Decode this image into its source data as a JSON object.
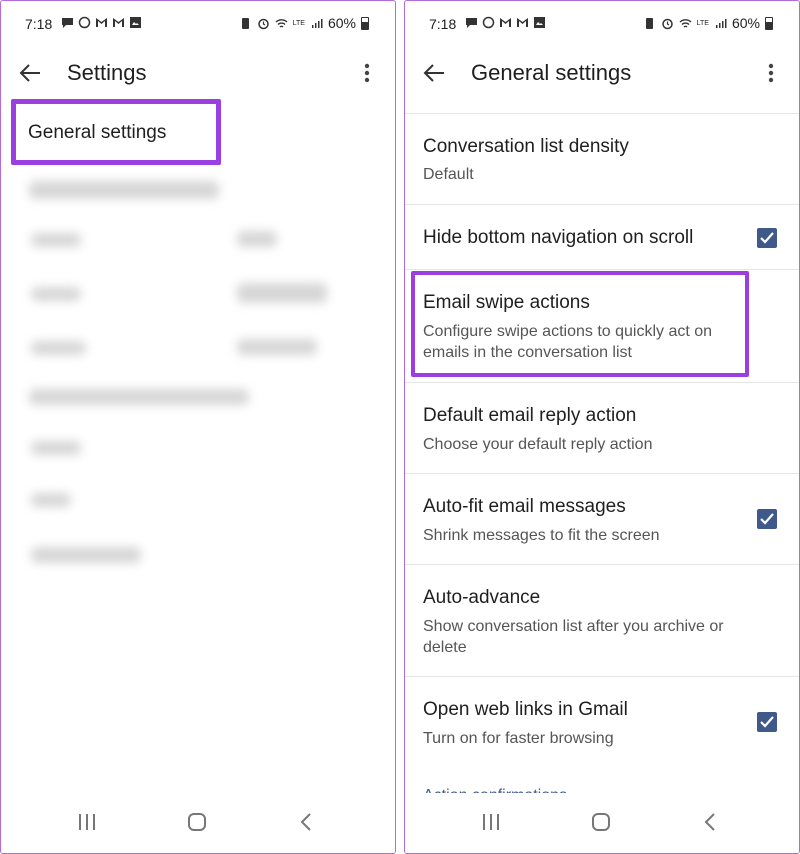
{
  "status_bar": {
    "time": "7:18",
    "battery": "60%",
    "network": "LTE"
  },
  "left_screen": {
    "title": "Settings",
    "highlighted_item": "General settings"
  },
  "right_screen": {
    "title": "General settings",
    "items": [
      {
        "title": "Conversation list density",
        "subtitle": "Default",
        "checkbox": false
      },
      {
        "title": "Hide bottom navigation on scroll",
        "subtitle": "",
        "checkbox": true
      },
      {
        "title": "Email swipe actions",
        "subtitle": "Configure swipe actions to quickly act on emails in the conversation list",
        "checkbox": false
      },
      {
        "title": "Default email reply action",
        "subtitle": "Choose your default reply action",
        "checkbox": false
      },
      {
        "title": "Auto-fit email messages",
        "subtitle": "Shrink messages to fit the screen",
        "checkbox": true
      },
      {
        "title": "Auto-advance",
        "subtitle": "Show conversation list after you archive or delete",
        "checkbox": false
      },
      {
        "title": "Open web links in Gmail",
        "subtitle": "Turn on for faster browsing",
        "checkbox": true
      }
    ],
    "section_header": "Action confirmations"
  },
  "colors": {
    "highlight": "#9b3fe0",
    "accent": "#3f5a8a",
    "frame": "#b36bd9"
  },
  "icons": [
    "back-arrow-icon",
    "more-vert-icon",
    "checkbox-checked-icon",
    "recents-nav-icon",
    "home-nav-icon",
    "back-nav-icon"
  ]
}
